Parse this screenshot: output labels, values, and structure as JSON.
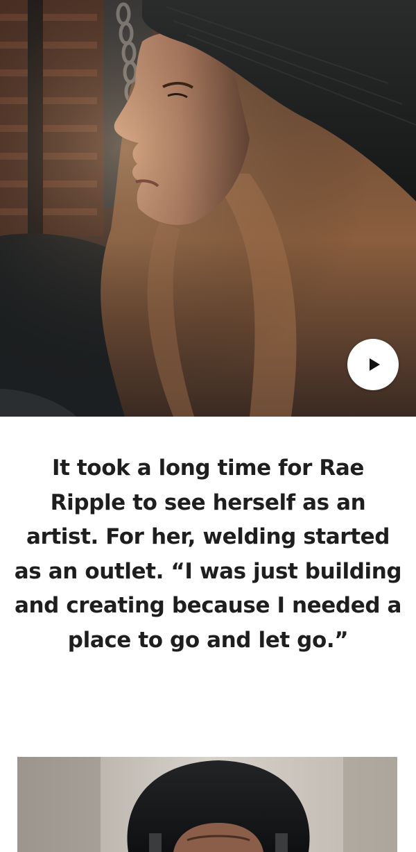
{
  "hero": {
    "play_icon": "play-icon",
    "play_button_color": "#ffffff"
  },
  "story": {
    "text": "It took a long time for Rae Ripple to see herself as an artist. For her, welding started as an outlet. “I was just building and creating because I needed a place to go and let go.”"
  },
  "colors": {
    "text": "#1e1e1e",
    "background": "#ffffff"
  }
}
